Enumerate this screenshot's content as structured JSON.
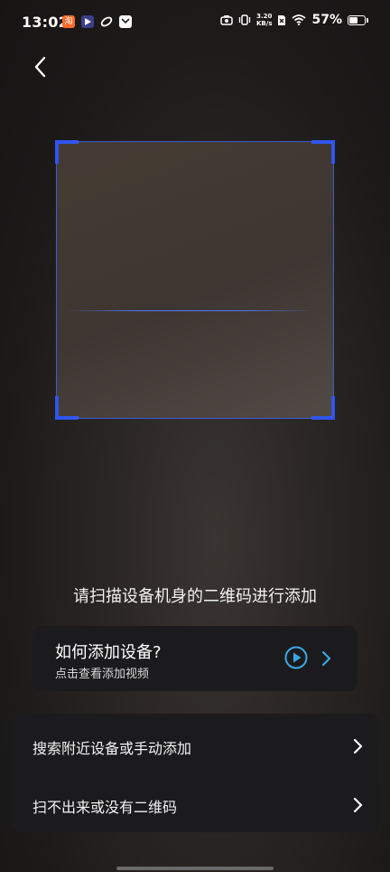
{
  "status_bar": {
    "time": "13:02",
    "net_speed_value": "3.20",
    "net_speed_unit": "KB/s",
    "battery_percent": "57%",
    "battery_level": 0.57,
    "notification_icons": [
      "taobao-icon",
      "video-app-icon",
      "link-app-icon",
      "mail-app-icon"
    ]
  },
  "scanner": {
    "accent_color": "#2f56f0"
  },
  "instruction_text": "请扫描设备机身的二维码进行添加",
  "help_card": {
    "title": "如何添加设备?",
    "subtitle": "点击查看添加视频",
    "accent_color": "#3aa7e8"
  },
  "options": [
    {
      "label": "搜索附近设备或手动添加"
    },
    {
      "label": "扫不出来或没有二维码"
    }
  ]
}
